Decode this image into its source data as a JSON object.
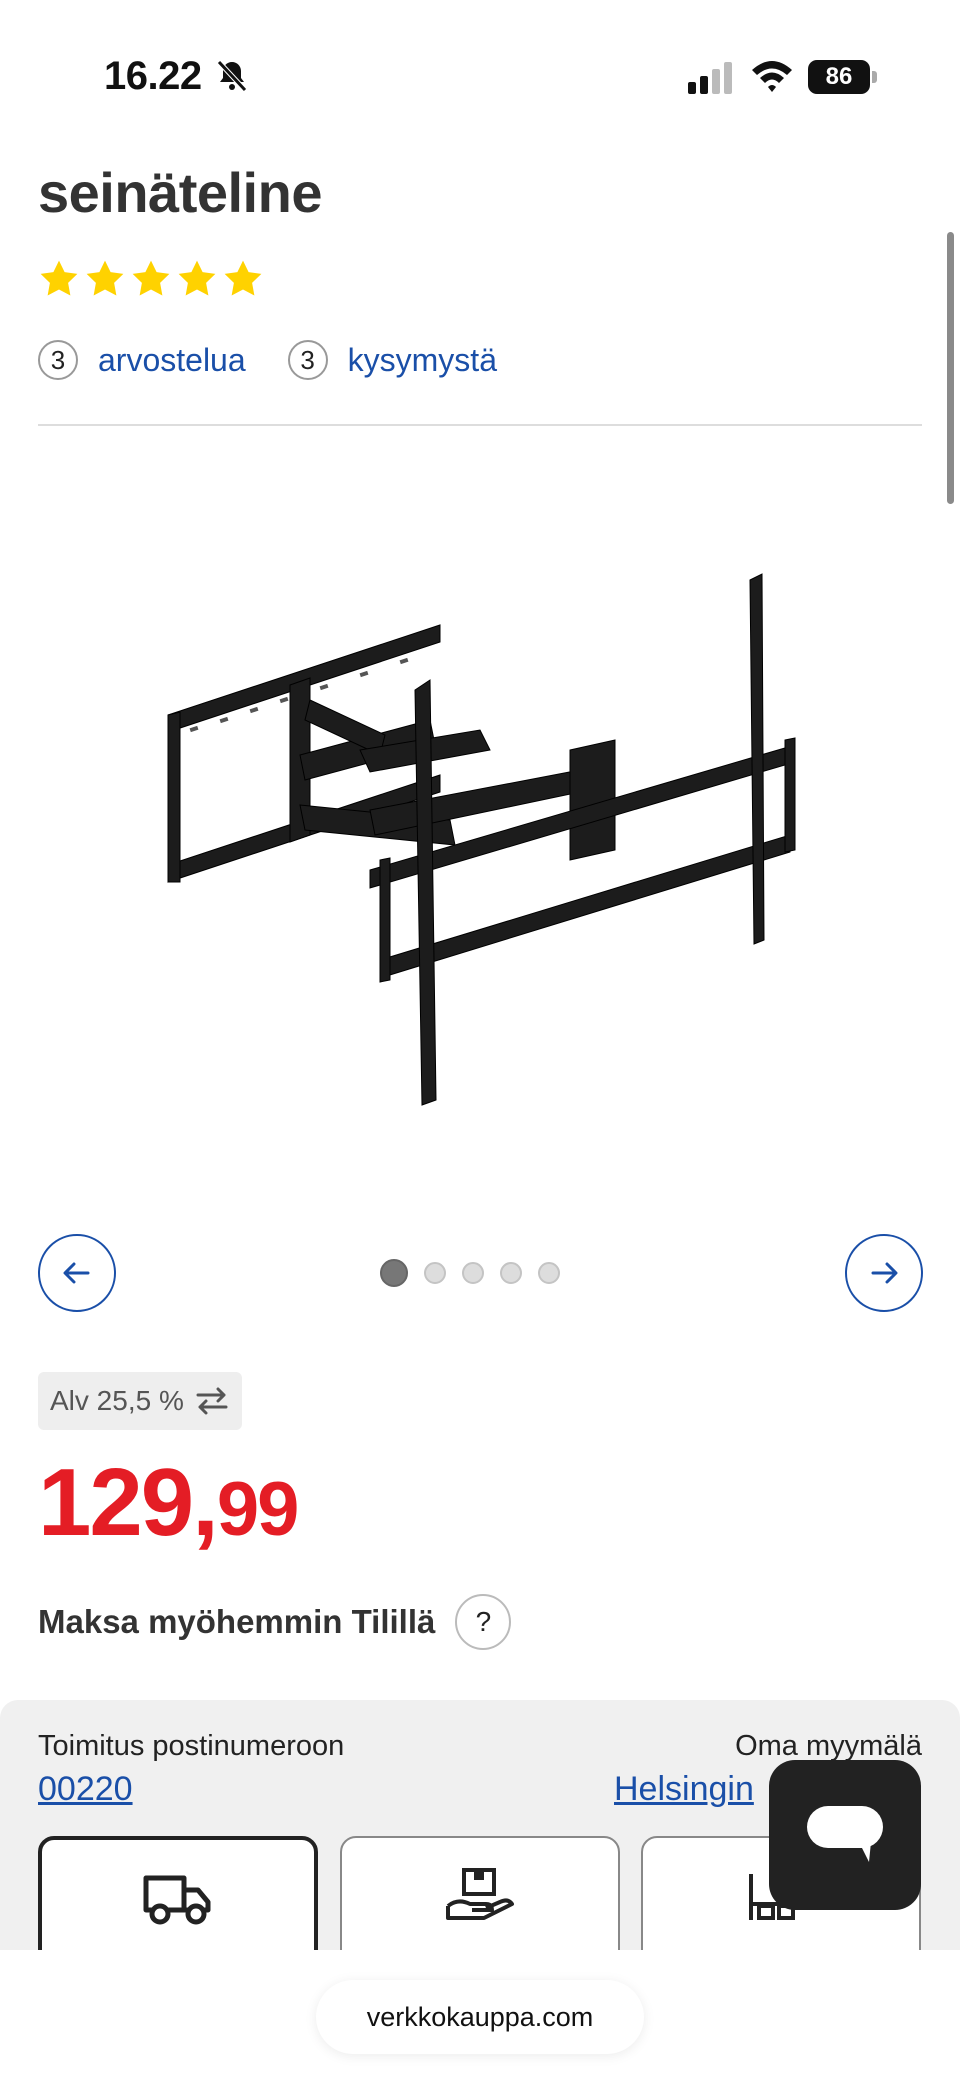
{
  "status": {
    "time": "16.22",
    "battery": "86"
  },
  "product": {
    "title": "seinäteline",
    "rating_stars": 5,
    "reviews_count": "3",
    "reviews_label": "arvostelua",
    "questions_count": "3",
    "questions_label": "kysymystä"
  },
  "carousel": {
    "image_count": 5,
    "active_index": 0
  },
  "pricing": {
    "vat_label": "Alv 25,5 %",
    "price_int": "129",
    "price_sep": ",",
    "price_dec": "99",
    "paylater_label": "Maksa myöhemmin Tilillä",
    "help_label": "?"
  },
  "delivery": {
    "delivery_label": "Toimitus postinumeroon",
    "postal_code": "00220",
    "store_label": "Oma myymälä",
    "store_name": "Helsingin"
  },
  "browser": {
    "url": "verkkokauppa.com"
  },
  "colors": {
    "price_red": "#e41d25",
    "link_blue": "#1a4fa8",
    "star_yellow": "#ffd200"
  }
}
